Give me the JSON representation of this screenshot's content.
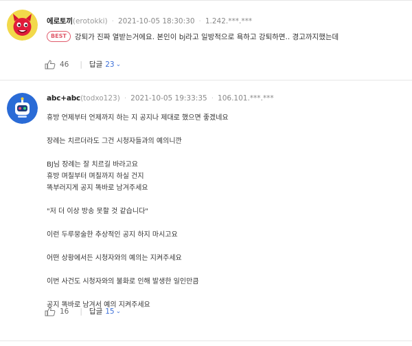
{
  "comments": [
    {
      "nick": "에로토끼",
      "user_id": "(erotokki)",
      "date": "2021-10-05 18:30:30",
      "ip": "1.242.***.***",
      "badge": "BEST",
      "text": "강퇴가 진짜 열받는거에요. 본인이 bj라고 일방적으로 욕하고 강퇴하면.. 경고까지했는데",
      "likes": "46",
      "reply_label": "답글",
      "reply_count": "23",
      "avatar_icon": "red-devil-avatar-icon"
    },
    {
      "nick": "abc+abc",
      "user_id": "(todxo123)",
      "date": "2021-10-05 19:33:35",
      "ip": "106.101.***.***",
      "lines": [
        "휴방 언제부터 언제까지 하는 지 공지나 제대로 했으면 좋겠네요",
        "장례는 치르더라도 그건 시청자들과의 예의니깐",
        "BJ님 장례는 잘 치르길 바라고요",
        "휴방 며칠부터 며칠까지 하실 건지",
        "똑부러지게 공지 똑바로 남겨주세요",
        "\"저 더 이상 방송 못할 것 같습니다\"",
        "이런 두루뭉술한 추상적인 공지 하지 마시고요",
        "어떤 상황에서든 시청자와의 예의는 지켜주세요",
        "이번 사건도 시청자와의 불화로 인해 발생한 일인만큼",
        "공지 똑바로 남겨서 예의 지켜주세요"
      ],
      "likes": "16",
      "reply_label": "답글",
      "reply_count": "15",
      "avatar_icon": "blue-robot-avatar-icon"
    }
  ],
  "separator": "·",
  "colors": {
    "best_badge": "#e0596a",
    "reply_count": "#3b6fd8",
    "divider": "#e6e6e6"
  }
}
